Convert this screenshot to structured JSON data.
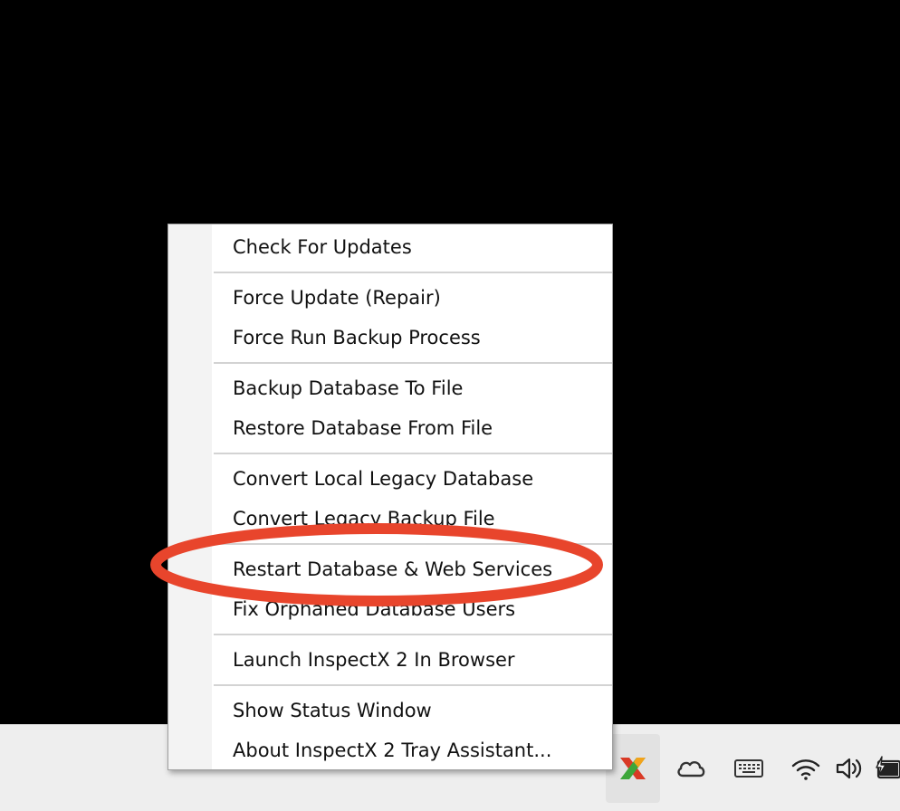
{
  "menu": {
    "items": [
      {
        "label": "Check For Updates"
      },
      {
        "label": "Force Update (Repair)"
      },
      {
        "label": "Force Run Backup Process"
      },
      {
        "label": "Backup Database To File"
      },
      {
        "label": "Restore Database From File"
      },
      {
        "label": "Convert Local Legacy Database"
      },
      {
        "label": "Convert Legacy Backup File"
      },
      {
        "label": "Restart Database & Web Services"
      },
      {
        "label": "Fix Orphaned Database Users"
      },
      {
        "label": "Launch InspectX 2 In Browser"
      },
      {
        "label": "Show Status Window"
      },
      {
        "label": "About InspectX 2 Tray Assistant..."
      }
    ]
  },
  "annotation": {
    "color": "#e8452c",
    "highlighted_item": "Restart Database & Web Services"
  },
  "taskbar": {
    "background": "#eeeeee",
    "tray_icons": [
      {
        "name": "inspectx-tray-icon"
      },
      {
        "name": "onedrive-cloud-icon"
      },
      {
        "name": "touch-keyboard-icon"
      },
      {
        "name": "wifi-icon"
      },
      {
        "name": "volume-icon"
      },
      {
        "name": "battery-charging-icon"
      }
    ]
  }
}
